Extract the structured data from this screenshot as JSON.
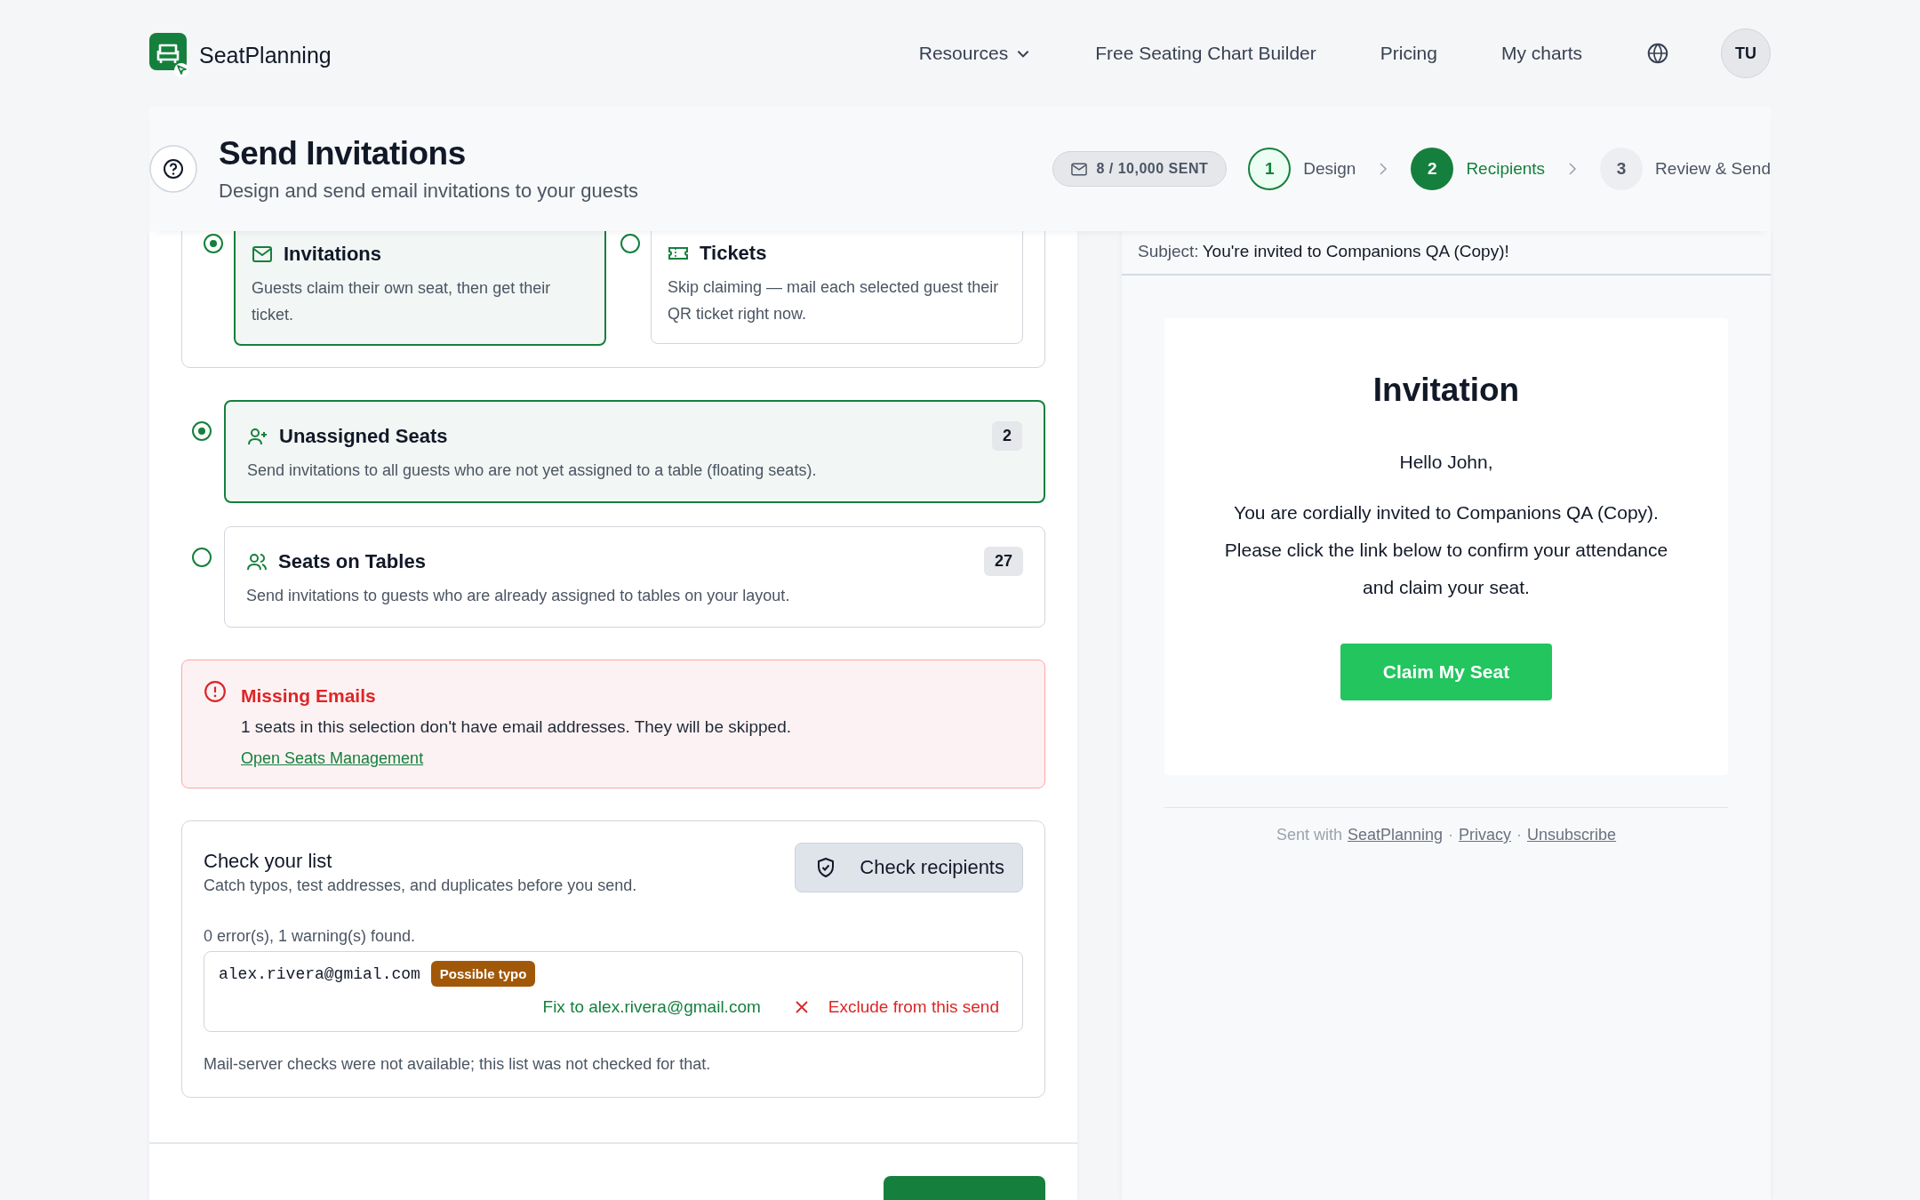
{
  "brand": {
    "name": "SeatPlanning"
  },
  "nav": [
    {
      "label": "Resources",
      "kind": "dropdown"
    },
    {
      "label": "Free Seating Chart Builder",
      "kind": "link"
    },
    {
      "label": "Pricing",
      "kind": "link"
    },
    {
      "label": "My charts",
      "kind": "link"
    }
  ],
  "avatar": "TU",
  "page": {
    "title": "Send Invitations",
    "subtitle": "Design and send email invitations to your guests"
  },
  "sent_counter": "8 / 10,000 SENT",
  "steps": [
    {
      "number": "1",
      "label": "Design",
      "selected": false
    },
    {
      "number": "2",
      "label": "Recipients",
      "selected": true
    },
    {
      "number": "3",
      "label": "Review & Send",
      "selected": false
    }
  ],
  "delivery_modes": [
    {
      "title": "Invitations",
      "description": "Guests claim their own seat, then get their ticket.",
      "selected": true
    },
    {
      "title": "Tickets",
      "description": "Skip claiming — mail each selected guest their QR ticket right now.",
      "selected": false
    }
  ],
  "audiences": [
    {
      "title": "Unassigned Seats",
      "description": "Send invitations to all guests who are not yet assigned to a table (floating seats).",
      "count": "2",
      "selected": true
    },
    {
      "title": "Seats on Tables",
      "description": "Send invitations to guests who are already assigned to tables on your layout.",
      "count": "27",
      "selected": false
    }
  ],
  "alert": {
    "title": "Missing Emails",
    "message": "1 seats in this selection don't have email addresses. They will be skipped.",
    "link": "Open Seats Management"
  },
  "check": {
    "title": "Check your list",
    "subtitle": "Catch typos, test addresses, and duplicates before you send.",
    "button": "Check recipients",
    "summary": "0 error(s), 1 warning(s) found.",
    "issues": [
      {
        "email": "alex.rivera@gmial.com",
        "tag": "Possible typo",
        "fix": "Fix to alex.rivera@gmail.com",
        "exclude": "Exclude from this send"
      }
    ],
    "note": "Mail-server checks were not available; this list was not checked for that."
  },
  "preview": {
    "subject_label": "Subject:",
    "subject": "You're invited to Companions QA (Copy)!",
    "heading": "Invitation",
    "greeting": "Hello John,",
    "body": "You are cordially invited to Companions QA (Copy). Please click the link below to confirm your attendance and claim your seat.",
    "button": "Claim My Seat",
    "footer": {
      "prefix": "Sent with",
      "separator": "·",
      "links": [
        "SeatPlanning",
        "Privacy",
        "Unsubscribe"
      ]
    }
  }
}
